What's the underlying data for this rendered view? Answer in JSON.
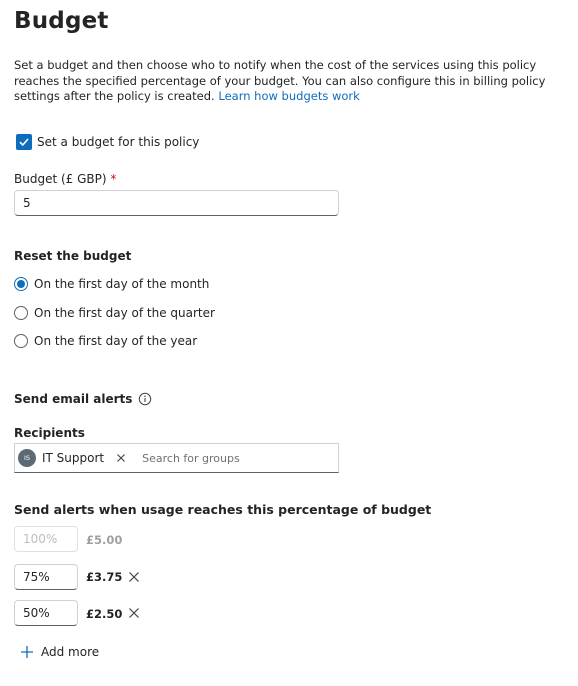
{
  "title": "Budget",
  "description": "Set a budget and then choose who to notify when the cost of the services using this policy reaches the specified percentage of your budget. You can also configure this in billing policy settings after the policy is created.",
  "learn_link": "Learn how budgets work",
  "set_budget": {
    "label": "Set a budget for this policy",
    "checked": true
  },
  "budget_field": {
    "label": "Budget (£ GBP)",
    "required_mark": "*",
    "value": "5"
  },
  "reset": {
    "heading": "Reset the budget",
    "options": [
      {
        "label": "On the first day of the month",
        "selected": true
      },
      {
        "label": "On the first day of the quarter",
        "selected": false
      },
      {
        "label": "On the first day of the year",
        "selected": false
      }
    ]
  },
  "email_alerts": {
    "heading": "Send email alerts",
    "info_icon": "info-icon"
  },
  "recipients": {
    "label": "Recipients",
    "chips": [
      {
        "initials": "IS",
        "name": "IT Support"
      }
    ],
    "placeholder": "Search for groups"
  },
  "alerts": {
    "heading": "Send alerts when usage reaches this percentage of budget",
    "rows": [
      {
        "percent": "100%",
        "amount": "£5.00",
        "disabled": true
      },
      {
        "percent": "75%",
        "amount": "£3.75",
        "disabled": false
      },
      {
        "percent": "50%",
        "amount": "£2.50",
        "disabled": false
      }
    ],
    "add_more": "Add more"
  },
  "colors": {
    "accent": "#0f6cbd",
    "required": "#c50f1f"
  }
}
